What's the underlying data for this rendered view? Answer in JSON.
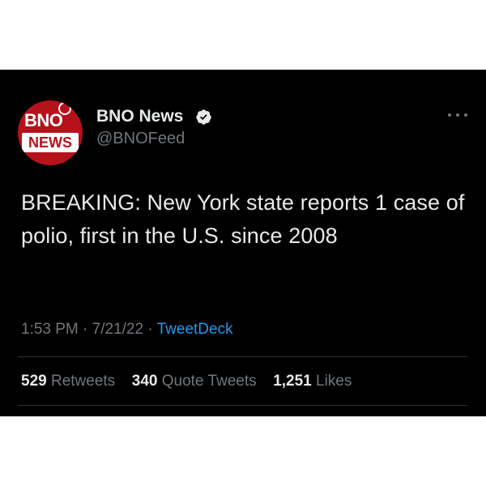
{
  "author": {
    "avatar_top_text": "BNO",
    "avatar_bottom_text": "NEWS",
    "display_name": "BNO News",
    "handle": "@BNOFeed",
    "verified_icon": "verified-badge-icon"
  },
  "tweet": {
    "text": "BREAKING: New York state reports 1 case of polio, first in the U.S. since 2008",
    "time": "1:53 PM",
    "date": "7/21/22",
    "separator": "·",
    "source": "TweetDeck"
  },
  "stats": {
    "retweets_count": "529",
    "retweets_label": "Retweets",
    "quotes_count": "340",
    "quotes_label": "Quote Tweets",
    "likes_count": "1,251",
    "likes_label": "Likes"
  },
  "colors": {
    "background": "#000000",
    "text_primary": "#e7e9ea",
    "text_secondary": "#71767b",
    "link": "#1d9bf0",
    "brand_red": "#b5121b",
    "divider": "#2f3336"
  }
}
